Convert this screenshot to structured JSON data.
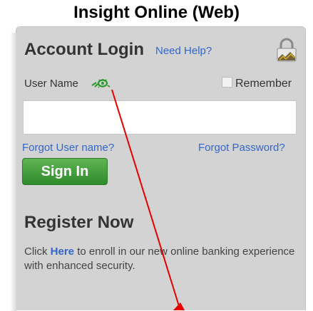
{
  "page_title": "Insight Online (Web)",
  "login": {
    "heading": "Account Login",
    "help_link": "Need Help?",
    "username_label": "User Name",
    "remember_label": "Remember",
    "username_value": "",
    "forgot_username": "Forgot User name?",
    "forgot_password": "Forgot Password?",
    "signin_label": "Sign In"
  },
  "register": {
    "heading": "Register Now",
    "text_before": "Click ",
    "link": "Here",
    "text_after": " to enroll in our new online banking experience with enhanced security."
  },
  "icons": {
    "lock": "lock-icon",
    "eye": "eye-icon",
    "checkbox": "checkbox"
  },
  "colors": {
    "link": "#3366cc",
    "signin_button": "#3a9a35",
    "annotation": "#e60000",
    "panel": "#d3d3d3"
  }
}
